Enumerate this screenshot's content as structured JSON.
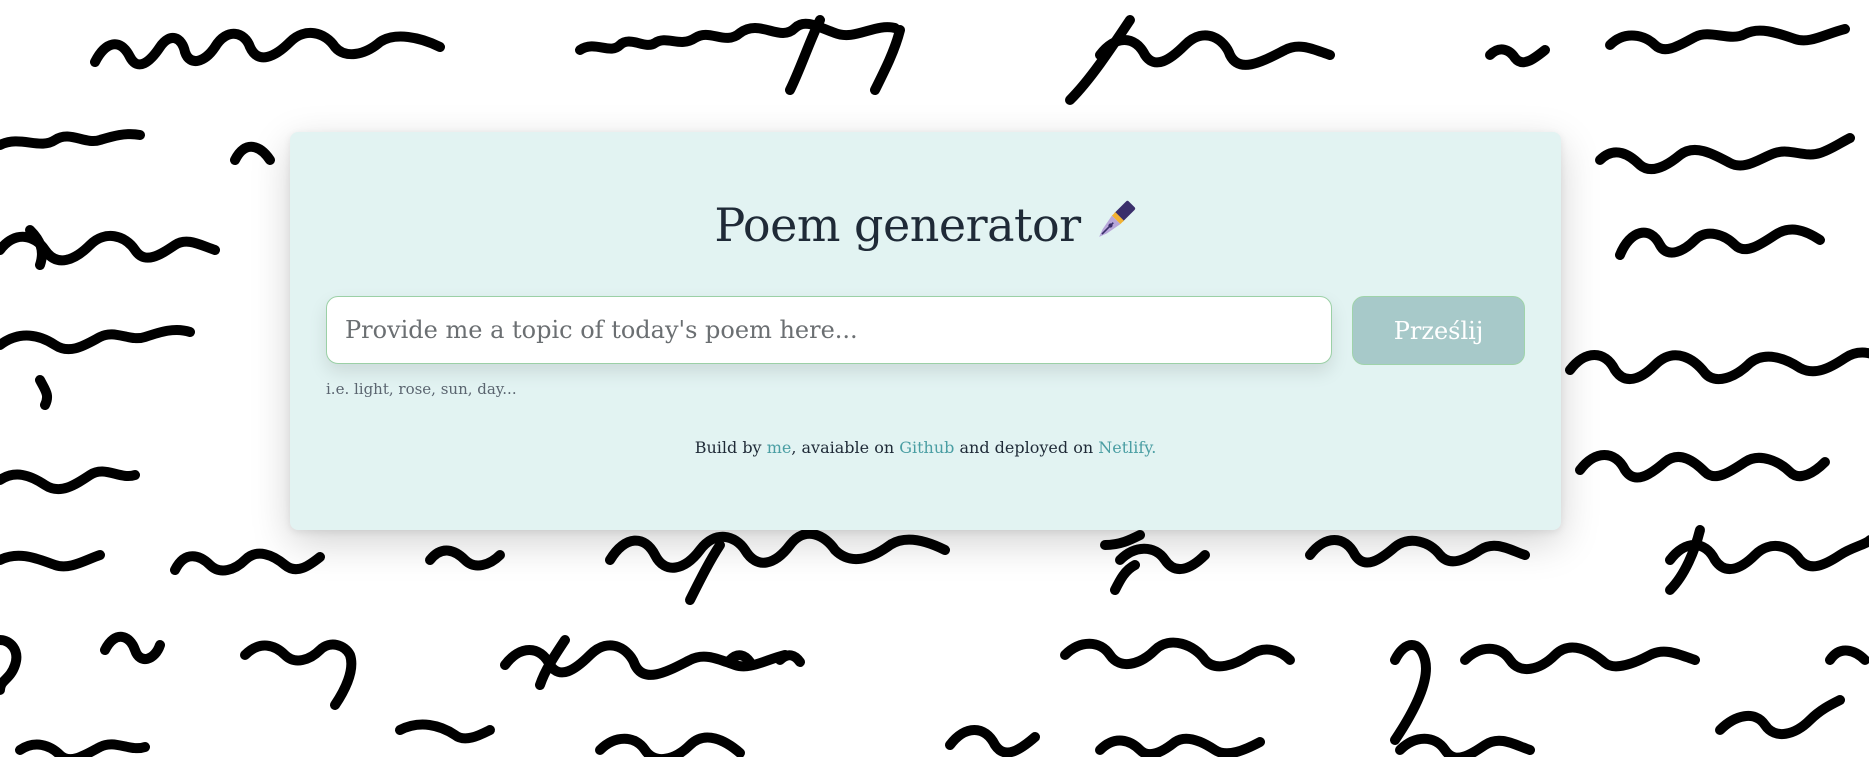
{
  "header": {
    "title": "Poem generator",
    "title_icon": "fountain-pen-icon"
  },
  "form": {
    "input_placeholder": "Provide me a topic of today's poem here...",
    "input_value": "",
    "submit_label": "Prześlij",
    "hint": "i.e. light, rose, sun, day..."
  },
  "footer": {
    "prefix": "Build by ",
    "me_link": "me",
    "mid1": ", avaiable on ",
    "github_link": "Github",
    "mid2": " and deployed on ",
    "netlify_link": "Netlify."
  },
  "colors": {
    "card_bg": "#e2f3f2",
    "link": "#4a9ea3",
    "button_bg": "#a7c9c9",
    "input_border": "#9bd0a6",
    "title_text": "#1f2a37"
  },
  "background": {
    "description_icon": "handwritten-script-background"
  }
}
